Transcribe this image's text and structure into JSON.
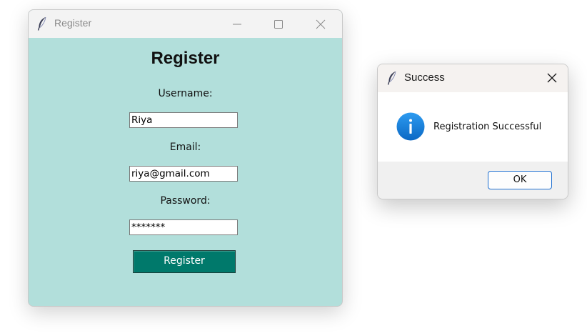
{
  "register_window": {
    "title": "Register",
    "heading": "Register",
    "username_label": "Username:",
    "username_value": "Riya",
    "email_label": "Email:",
    "email_value": "riya@gmail.com",
    "password_label": "Password:",
    "password_value": "*******",
    "register_button": "Register",
    "colors": {
      "background": "#b2dfdb",
      "button": "#00796b",
      "button_text": "#ffffff"
    },
    "icons": [
      "feather-icon",
      "minimize-icon",
      "maximize-icon",
      "close-icon"
    ]
  },
  "success_dialog": {
    "title": "Success",
    "message": "Registration Successful",
    "ok_button": "OK",
    "icons": [
      "feather-icon",
      "close-icon",
      "info-icon"
    ],
    "colors": {
      "info": "#1a7fd4",
      "ok_border": "#1e6fd0"
    }
  }
}
